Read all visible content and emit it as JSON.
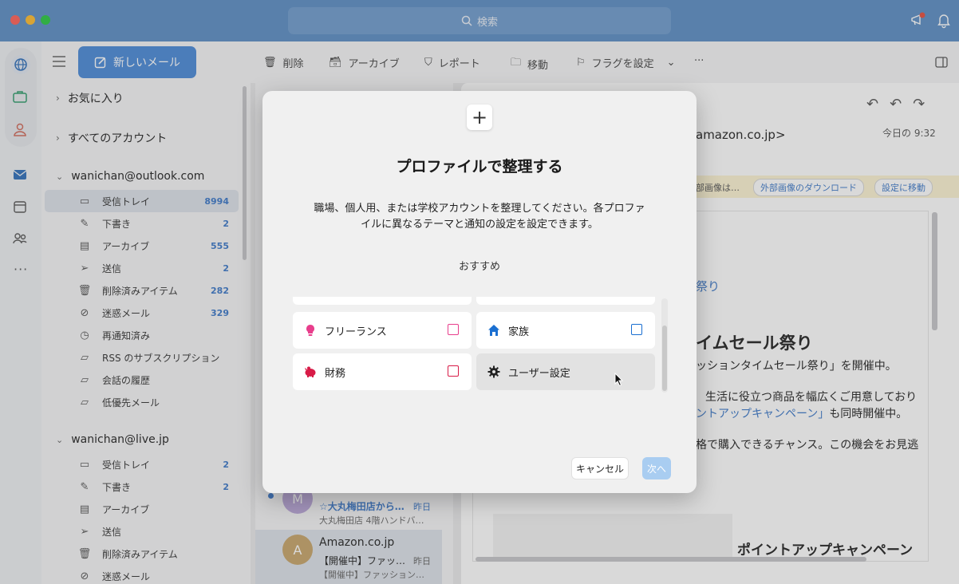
{
  "window": {
    "search_placeholder": "検索"
  },
  "folder_pane": {
    "new_mail_label": "新しいメール",
    "favorites": "お気に入り",
    "all_accounts": "すべてのアカウント",
    "account1": {
      "name": "wanichan@outlook.com",
      "items": [
        {
          "label": "受信トレイ",
          "count": "8994",
          "icon": "inbox-icon"
        },
        {
          "label": "下書き",
          "count": "2",
          "icon": "draft-icon"
        },
        {
          "label": "アーカイブ",
          "count": "555",
          "icon": "archive-icon"
        },
        {
          "label": "送信",
          "count": "2",
          "icon": "send-icon"
        },
        {
          "label": "削除済みアイテム",
          "count": "282",
          "icon": "trash-icon"
        },
        {
          "label": "迷惑メール",
          "count": "329",
          "icon": "junk-icon"
        },
        {
          "label": "再通知済み",
          "count": "",
          "icon": "clock-icon"
        },
        {
          "label": "RSS のサブスクリプション",
          "count": "",
          "icon": "folder-icon"
        },
        {
          "label": "会話の履歴",
          "count": "",
          "icon": "folder-icon"
        },
        {
          "label": "低優先メール",
          "count": "",
          "icon": "folder-icon"
        }
      ]
    },
    "account2": {
      "name": "wanichan@live.jp",
      "items": [
        {
          "label": "受信トレイ",
          "count": "2",
          "icon": "inbox-icon"
        },
        {
          "label": "下書き",
          "count": "2",
          "icon": "draft-icon"
        },
        {
          "label": "アーカイブ",
          "count": "",
          "icon": "archive-icon"
        },
        {
          "label": "送信",
          "count": "",
          "icon": "send-icon"
        },
        {
          "label": "削除済みアイテム",
          "count": "",
          "icon": "trash-icon"
        },
        {
          "label": "迷惑メール",
          "count": "",
          "icon": "junk-icon"
        }
      ]
    }
  },
  "toolbar": {
    "delete": "削除",
    "archive": "アーカイブ",
    "report": "レポート",
    "move": "移動",
    "flag": "フラグを設定"
  },
  "messages": [
    {
      "avatar": "M",
      "avatar_color": "#b9a6d8",
      "sender": "",
      "subject": "☆大丸梅田店から…",
      "date": "昨日",
      "preview": "大丸梅田店 4階ハンドバ…"
    },
    {
      "avatar": "A",
      "avatar_color": "#c7a56a",
      "sender": "Amazon.co.jp",
      "subject": "【開催中】ファッ…",
      "date": "昨日",
      "preview": "【開催中】ファッション…"
    }
  ],
  "reading": {
    "from_tail": "amazon.co.jp>",
    "time": "今日の 9:32",
    "image_notice": "部画像は…",
    "download_images": "外部画像のダウンロード",
    "go_settings": "設定に移動",
    "link_tail": "祭り",
    "heading": "イムセール祭り",
    "line1": "ッションタイムセール祭り」を開催中。",
    "line2": "生活に役立つ商品を幅広くご用意しており",
    "line3_link": "ントアップキャンペーン」",
    "line3_rest": "も同時開催中。",
    "line4": "格で購入できるチャンス。この機会をお見逃",
    "footer_heading": "ポイントアップキャンペーン"
  },
  "dialog": {
    "title": "プロファイルで整理する",
    "description": "職場、個人用、または学校アカウントを整理してください。各プロファイルに異なるテーマと通知の設定を設定できます。",
    "recommended": "おすすめ",
    "cards": [
      {
        "label": "フリーランス",
        "icon": "lightbulb-icon",
        "color": "#e83e8c"
      },
      {
        "label": "家族",
        "icon": "house-icon",
        "color": "#1a6fd1"
      },
      {
        "label": "財務",
        "icon": "piggybank-icon",
        "color": "#d81b47"
      },
      {
        "label": "ユーザー設定",
        "icon": "gear-icon",
        "color": "#222222"
      }
    ],
    "cancel": "キャンセル",
    "next": "次へ"
  }
}
